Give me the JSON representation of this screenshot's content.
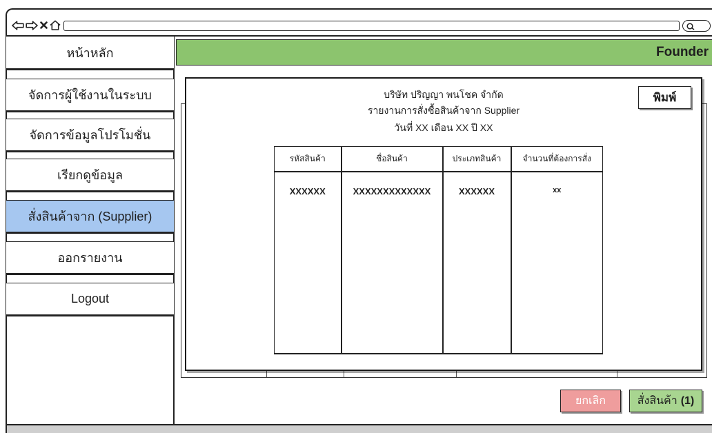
{
  "browser": {
    "back_icon": "back-arrow-icon",
    "forward_icon": "forward-arrow-icon",
    "stop_icon": "close-icon",
    "home_icon": "home-icon",
    "search_icon": "search-icon"
  },
  "sidebar": {
    "selected_index": 4,
    "items": [
      {
        "label": "หน้าหลัก"
      },
      {
        "label": "จัดการผู้ใช้งานในระบบ"
      },
      {
        "label": "จัดการข้อมูลโปรโมชั่น"
      },
      {
        "label": "เรียกดูข้อมูล"
      },
      {
        "label": "สั่งสินค้าจาก (Supplier)"
      },
      {
        "label": "ออกรายงาน"
      },
      {
        "label": "Logout"
      }
    ]
  },
  "header": {
    "user_label": "Founder"
  },
  "report": {
    "company": "บริษัท ปริญญา พนโชค จำกัด",
    "title": "รายงานการสั่งซื้อสินค้าจาก Supplier",
    "date": "วันที่ XX เดือน XX ปี XX",
    "print_label": "พิมพ์",
    "columns": [
      "รหัสสินค้า",
      "ชื่อสินค้า",
      "ประเภทสินค้า",
      "จำนวนที่ต้องการสั่ง"
    ],
    "rows": [
      [
        "XXXXXX",
        "XXXXXXXXXXXXX",
        "XXXXXX",
        "xx"
      ]
    ]
  },
  "actions": {
    "cancel_label": "ยกเลิก",
    "order_label": "สั่งสินค้า",
    "order_count": "(1)"
  },
  "colors": {
    "header_bg": "#8cc46e",
    "selected_bg": "#a6c7f0",
    "cancel_bg": "#ef9d9d",
    "order_bg": "#a8d590",
    "ink": "#222222"
  }
}
